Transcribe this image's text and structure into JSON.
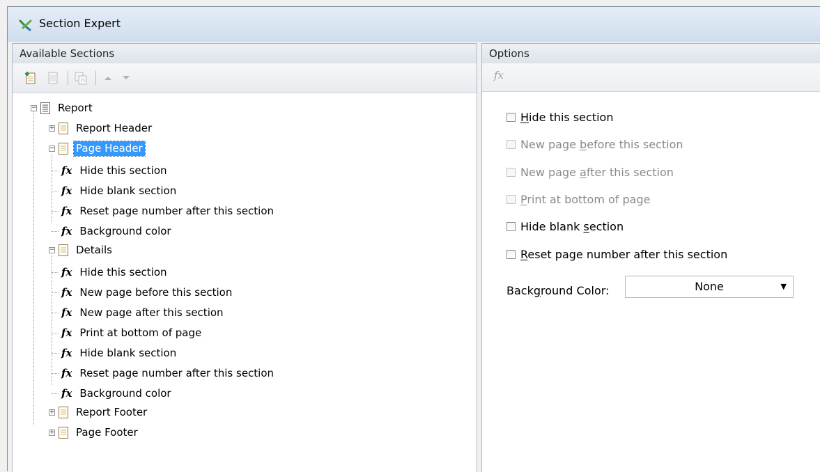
{
  "window": {
    "title": "Section Expert"
  },
  "left_panel": {
    "header": "Available Sections",
    "toolbar": [
      "insert-section-icon",
      "delete-section-icon",
      "merge-section-icon",
      "move-up-icon",
      "move-down-icon"
    ],
    "tree": {
      "root": "Report",
      "report_header": "Report Header",
      "page_header": "Page Header",
      "page_header_children": [
        "Hide this section",
        "Hide blank section",
        "Reset page number after this section",
        "Background color"
      ],
      "details": "Details",
      "details_children": [
        "Hide this section",
        "New page before this section",
        "New page after this section",
        "Print at bottom of page",
        "Hide blank section",
        "Reset page number after this section",
        "Background color"
      ],
      "report_footer": "Report Footer",
      "page_footer": "Page Footer"
    }
  },
  "right_panel": {
    "header": "Options",
    "options": {
      "hide_section": {
        "pre": "",
        "ul": "H",
        "post": "ide this section",
        "checked": false,
        "enabled": true
      },
      "new_page_before": {
        "pre": "New page ",
        "ul": "b",
        "post": "efore this section",
        "checked": false,
        "enabled": false
      },
      "new_page_after": {
        "pre": "New page ",
        "ul": "a",
        "post": "fter this section",
        "checked": false,
        "enabled": false
      },
      "print_bottom": {
        "pre": "",
        "ul": "P",
        "post": "rint at bottom of page",
        "checked": false,
        "enabled": false
      },
      "hide_blank": {
        "pre": "Hide blank ",
        "ul": "s",
        "post": "ection",
        "checked": false,
        "enabled": true
      },
      "reset_page": {
        "pre": "",
        "ul": "R",
        "post": "eset page number after this section",
        "checked": false,
        "enabled": true
      }
    },
    "background": {
      "pre": "Back",
      "ul": "g",
      "post": "round Color:",
      "value": "None"
    }
  }
}
